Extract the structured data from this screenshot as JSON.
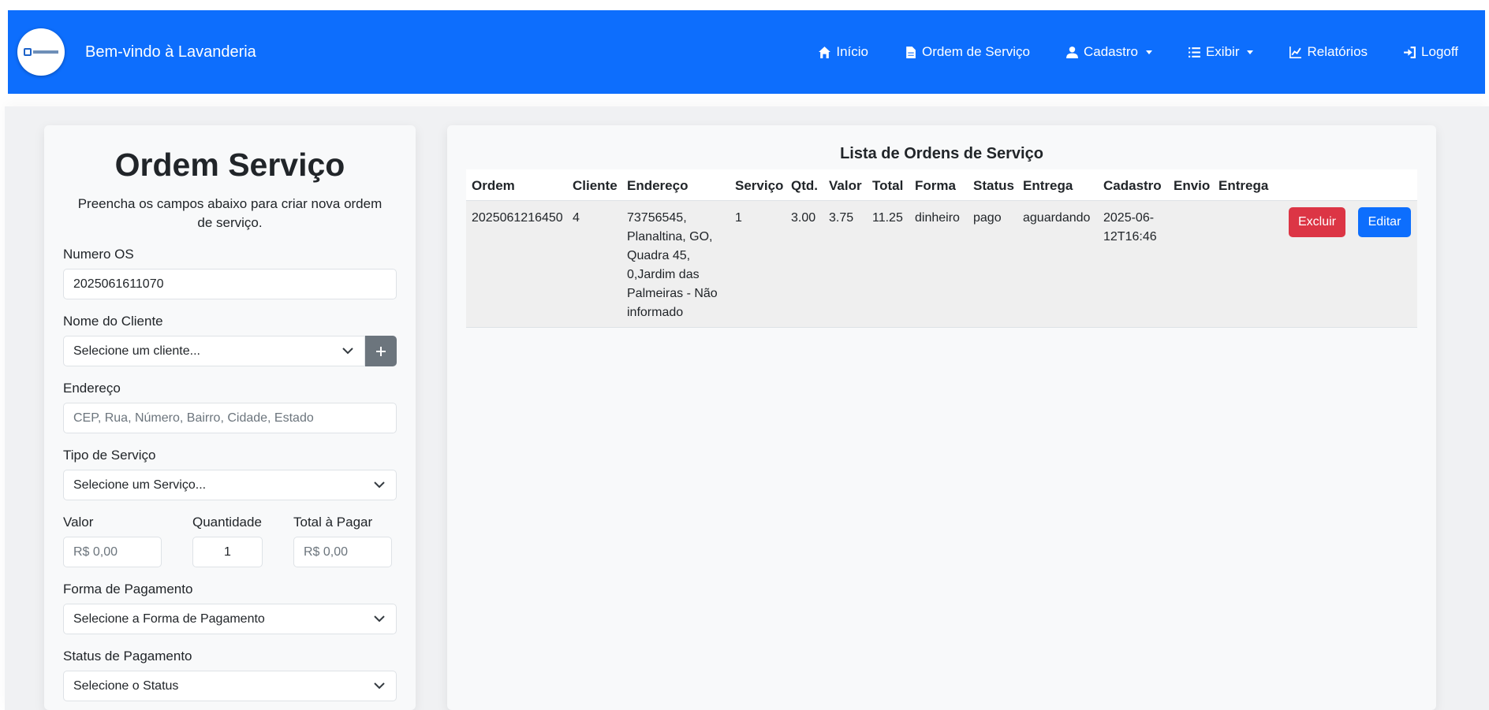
{
  "navbar": {
    "brand": "Bem-vindo à Lavanderia",
    "items": [
      {
        "icon": "home-icon",
        "label": "Início"
      },
      {
        "icon": "document-icon",
        "label": "Ordem de Serviço"
      },
      {
        "icon": "user-icon",
        "label": "Cadastro",
        "dropdown": true
      },
      {
        "icon": "list-icon",
        "label": "Exibir",
        "dropdown": true
      },
      {
        "icon": "chart-icon",
        "label": "Relatórios"
      },
      {
        "icon": "logout-icon",
        "label": "Logoff"
      }
    ]
  },
  "form": {
    "title": "Ordem Serviço",
    "subtitle": "Preencha os campos abaixo para criar nova ordem de serviço.",
    "numero_os_label": "Numero OS",
    "numero_os_value": "2025061611070",
    "cliente_label": "Nome do Cliente",
    "cliente_value": "Selecione um cliente...",
    "endereco_label": "Endereço",
    "endereco_placeholder": "CEP, Rua, Número, Bairro, Cidade, Estado",
    "servico_label": "Tipo de Serviço",
    "servico_value": "Selecione um Serviço...",
    "valor_label": "Valor",
    "valor_placeholder": "R$ 0,00",
    "quantidade_label": "Quantidade",
    "quantidade_value": "1",
    "total_label": "Total à Pagar",
    "total_placeholder": "R$ 0,00",
    "forma_label": "Forma de Pagamento",
    "forma_value": "Selecione a Forma de Pagamento",
    "status_label": "Status de Pagamento",
    "status_value": "Selecione o Status"
  },
  "list": {
    "title": "Lista de Ordens de Serviço",
    "headers": [
      "Ordem",
      "Cliente",
      "Endereço",
      "Serviço",
      "Qtd.",
      "Valor",
      "Total",
      "Forma",
      "Status",
      "Entrega",
      "Cadastro",
      "Envio",
      "Entrega"
    ],
    "rows": [
      {
        "ordem": "2025061216450",
        "cliente": "4",
        "endereco": [
          "73756545,",
          "Planaltina, GO,",
          "Quadra 45,",
          "0,Jardim das",
          "Palmeiras - Não",
          "informado"
        ],
        "servico": "1",
        "qtd": "3.00",
        "valor": "3.75",
        "total": "11.25",
        "forma": "dinheiro",
        "status": "pago",
        "entrega": "aguardando",
        "cadastro": [
          "2025-06-",
          "12T16:46"
        ],
        "envio": "",
        "entrega2": "",
        "delete_label": "Excluir",
        "edit_label": "Editar"
      }
    ]
  },
  "colors": {
    "primary": "#0d6efd",
    "danger": "#dc3545",
    "secondary": "#6c757d"
  }
}
